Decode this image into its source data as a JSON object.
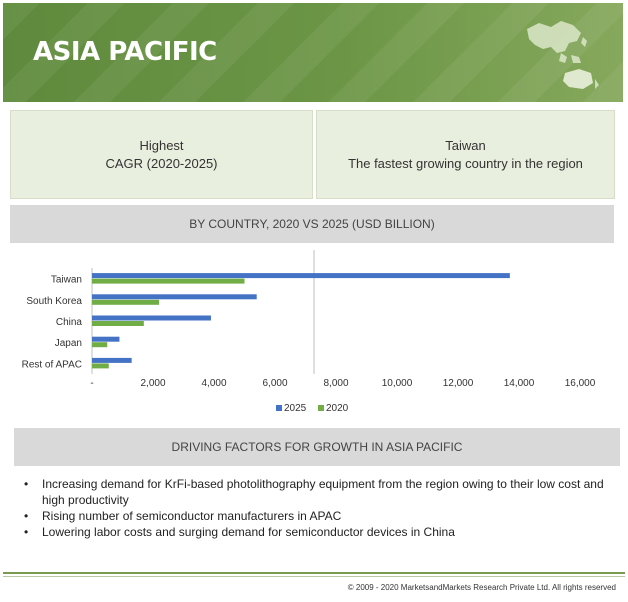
{
  "banner": {
    "title": "ASIA PACIFIC"
  },
  "cards": {
    "left": {
      "line1": "Highest",
      "line2": "CAGR (2020-2025)"
    },
    "right": {
      "line1": "Taiwan",
      "line2": "The fastest growing country in the region"
    }
  },
  "chart_title": "BY COUNTRY, 2020 VS 2025 (USD BILLION)",
  "chart_data": {
    "type": "bar",
    "orientation": "horizontal",
    "title": "BY COUNTRY, 2020 VS 2025 (USD BILLION)",
    "categories": [
      "Taiwan",
      "South Korea",
      "China",
      "Japan",
      "Rest of APAC"
    ],
    "series": [
      {
        "name": "2025",
        "color": "#4472c4",
        "values": [
          13700,
          5400,
          3900,
          900,
          1300
        ]
      },
      {
        "name": "2020",
        "color": "#70ad47",
        "values": [
          5000,
          2200,
          1700,
          500,
          550
        ]
      }
    ],
    "xlim": [
      0,
      16000
    ],
    "x_ticks": [
      0,
      2000,
      4000,
      6000,
      8000,
      10000,
      12000,
      14000,
      16000
    ],
    "x_tick_labels": [
      "-",
      "2,000",
      "4,000",
      "6,000",
      "8,000",
      "10,000",
      "12,000",
      "14,000",
      "16,000"
    ],
    "legend": "bottom",
    "grid": false
  },
  "drivers": {
    "title": "DRIVING FACTORS FOR GROWTH IN ASIA PACIFIC",
    "items": [
      "Increasing demand for KrFi-based photolithography equipment from the region owing to their low cost and high productivity",
      "Rising number of semiconductor manufacturers in APAC",
      "Lowering labor costs and surging demand for semiconductor devices in China"
    ]
  },
  "footer": "© 2009 - 2020 MarketsandMarkets Research Private Ltd. All rights reserved",
  "colors": {
    "banner": "#6c9646",
    "card_bg": "#e9efdf",
    "header_gray": "#d9d9d9",
    "series_2025": "#4472c4",
    "series_2020": "#70ad47"
  }
}
